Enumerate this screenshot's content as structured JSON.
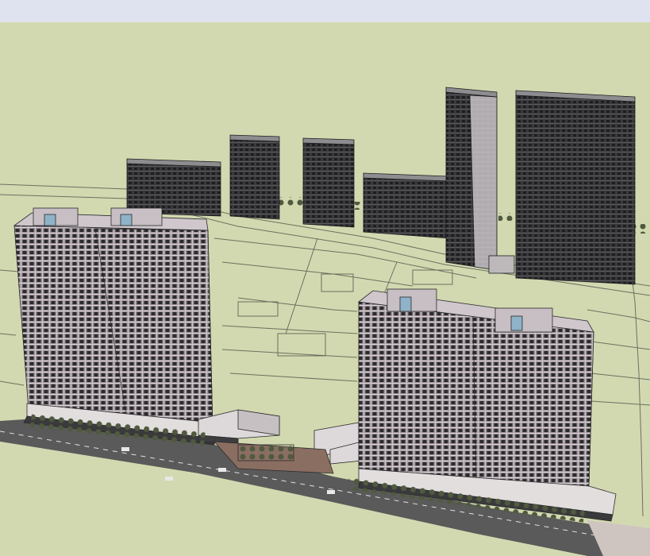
{
  "viewport": {
    "sky_color": "#dfe3ef",
    "ground_color": "#d2d9b0",
    "linework_color": "#6b7060",
    "road_color": "#5a5a5a",
    "tower_dark_color": "#2e2e30",
    "tower_light_color": "#e8e4e6",
    "tower_mauve_color": "#8a7f86"
  }
}
